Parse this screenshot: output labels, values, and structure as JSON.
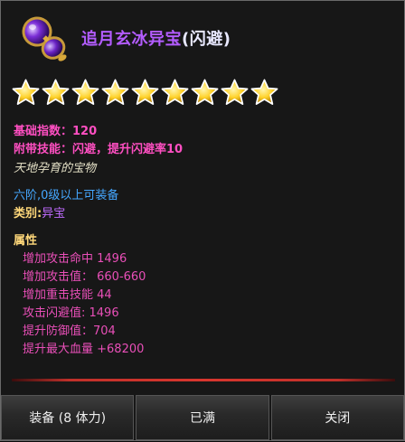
{
  "item": {
    "icon": "purple-orb-gourd-icon",
    "name_main": "追月玄冰异宝",
    "name_suffix": "(闪避)",
    "stars": 9,
    "base_index_label": "基础指数：",
    "base_index_value": "120",
    "skill_label": "附带技能：",
    "skill_value": "闪避，提升闪避率10",
    "flavor": "天地孕育的宝物",
    "requirement": "六阶,0级以上可装备",
    "category_label": "类别:",
    "category_value": "异宝",
    "attr_heading": "属性",
    "attributes": [
      "增加攻击命中 1496",
      "增加攻击值： 660-660",
      "增加重击技能 44",
      "攻击闪避值: 1496",
      "提升防御值：704",
      "提升最大血量 +68200"
    ]
  },
  "buttons": {
    "equip": "装备 (8 体力)",
    "full": "已满",
    "close": "关闭"
  },
  "colors": {
    "title": "#b35cff",
    "attribute": "#e94fb8",
    "requirement": "#45a7ff",
    "star": "#ffd22a"
  }
}
